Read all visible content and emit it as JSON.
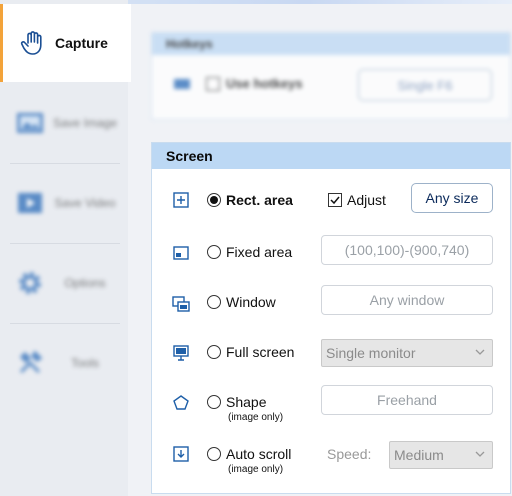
{
  "sidebar": {
    "items": [
      {
        "label": "Capture",
        "icon": "hand-icon",
        "active": true
      },
      {
        "label": "Save Image",
        "icon": "image-icon"
      },
      {
        "label": "Save Video",
        "icon": "video-icon"
      },
      {
        "label": "Options",
        "icon": "gear-icon"
      },
      {
        "label": "Tools",
        "icon": "tools-icon"
      }
    ]
  },
  "hotkeys": {
    "title": "Hotkeys",
    "use_label": "Use hotkeys",
    "key_button": "Single F6"
  },
  "screen": {
    "title": "Screen",
    "rect": {
      "label": "Rect. area",
      "adjust_label": "Adjust",
      "size_button": "Any size"
    },
    "fixed": {
      "label": "Fixed area",
      "value": "(100,100)-(900,740)"
    },
    "window": {
      "label": "Window",
      "value": "Any window"
    },
    "full": {
      "label": "Full screen",
      "selected": "Single monitor"
    },
    "shape": {
      "label": "Shape",
      "note": "(image only)",
      "value": "Freehand"
    },
    "auto": {
      "label": "Auto scroll",
      "note": "(image only)",
      "speed_label": "Speed:",
      "selected": "Medium"
    }
  },
  "colors": {
    "accent": "#f3a33a",
    "header": "#bcd8f4",
    "icon_blue": "#1e5fa8"
  }
}
